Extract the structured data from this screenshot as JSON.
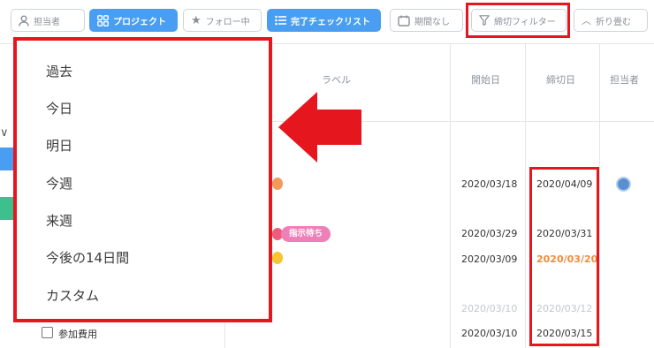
{
  "toolbar": {
    "assignee": "担当者",
    "project": "プロジェクト",
    "follow": "フォロー中",
    "checklist": "完了チェックリスト",
    "no_period": "期間なし",
    "deadline_filter": "締切フィルター",
    "collapse": "折り畳む"
  },
  "columns": {
    "label": "ラベル",
    "start": "開始日",
    "deadline": "締切日",
    "assignee": "担当者"
  },
  "dropdown": {
    "items": [
      "過去",
      "今日",
      "明日",
      "今週",
      "来週",
      "今後の14日間",
      "カスタム"
    ]
  },
  "rows": [
    {
      "start": "2020/03/18",
      "deadline": "2020/04/09"
    },
    {
      "tag": "指示待ち",
      "start": "2020/03/29",
      "deadline": "2020/03/31"
    },
    {
      "start": "2020/03/09",
      "deadline": "2020/03/20"
    },
    {
      "start": "2020/03/10",
      "deadline": "2020/03/12"
    },
    {
      "task": "参加費用",
      "start": "2020/03/10",
      "deadline": "2020/03/15"
    }
  ],
  "colors": {
    "highlight": "#e5161e",
    "accent_blue": "#4a9ef2",
    "tag_pink": "#ee7fb8",
    "overdue_orange": "#ef8b3a"
  }
}
